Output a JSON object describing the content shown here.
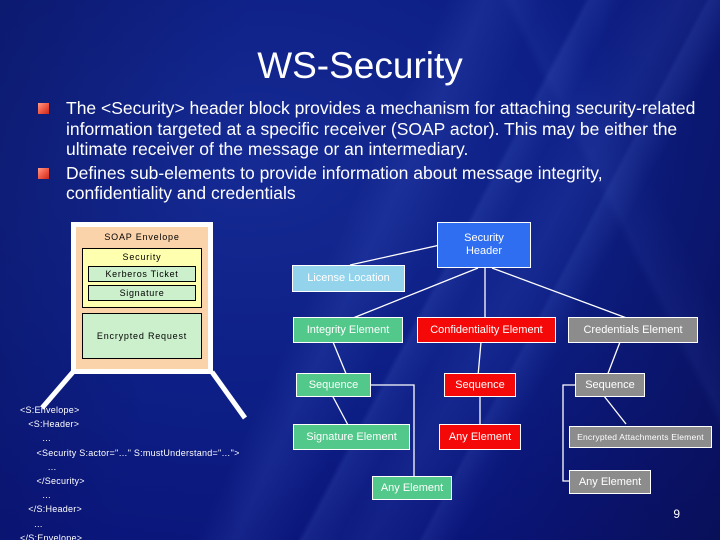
{
  "slide": {
    "title": "WS-Security",
    "page_number": "9",
    "background_color": "#0a1580"
  },
  "bullets": [
    {
      "text": "The <Security> header block provides a mechanism for attaching security-related information targeted at a specific receiver (SOAP actor).  This may be either the ultimate receiver of the message or an intermediary."
    },
    {
      "text": "Defines sub-elements to provide information about message integrity, confidentiality and credentials"
    }
  ],
  "soap_envelope": {
    "label": "SOAP Envelope",
    "security": {
      "label": "Security",
      "items": [
        {
          "label": "Kerberos Ticket"
        },
        {
          "label": "Signature"
        }
      ]
    },
    "body": {
      "label": "Encrypted Request"
    }
  },
  "xml_snippet": {
    "lines": [
      "<S:Envelope>",
      "   <S:Header>",
      "        …",
      "      <Security S:actor=\"…\" S:mustUnderstand=\"…\">",
      "          …",
      "      </Security>",
      "        …",
      "   </S:Header>",
      "     …",
      "<S:Envelope>"
    ],
    "text": "<S:Envelope>\n   <S:Header>\n        …\n      <Security S:actor=\"…\" S:mustUnderstand=\"…\">\n          …\n      </Security>\n        …\n   </S:Header>\n     …\n</S:Envelope>"
  },
  "tree": {
    "nodes": {
      "security_header": {
        "label": "Security\nHeader",
        "color": "#2f6ef0"
      },
      "license_location": {
        "label": "License Location",
        "color": "#93d3ec"
      },
      "integrity_element": {
        "label": "Integrity Element",
        "color": "#52c98a"
      },
      "confidentiality_element": {
        "label": "Confidentiality Element",
        "color": "#f50808"
      },
      "credentials_element": {
        "label": "Credentials Element",
        "color": "#8c8c8c"
      },
      "integrity_sequence": {
        "label": "Sequence",
        "color": "#52c98a"
      },
      "confidentiality_sequence": {
        "label": "Sequence",
        "color": "#f50808"
      },
      "credentials_sequence": {
        "label": "Sequence",
        "color": "#8c8c8c"
      },
      "signature_element": {
        "label": "Signature Element",
        "color": "#52c98a"
      },
      "confidentiality_any_element": {
        "label": "Any Element",
        "color": "#f50808"
      },
      "encrypted_attachments_element": {
        "label": "Encrypted Attachments Element",
        "color": "#8c8c8c"
      },
      "integrity_any_element": {
        "label": "Any Element",
        "color": "#52c98a"
      },
      "credentials_any_element": {
        "label": "Any Element",
        "color": "#8c8c8c"
      }
    }
  }
}
